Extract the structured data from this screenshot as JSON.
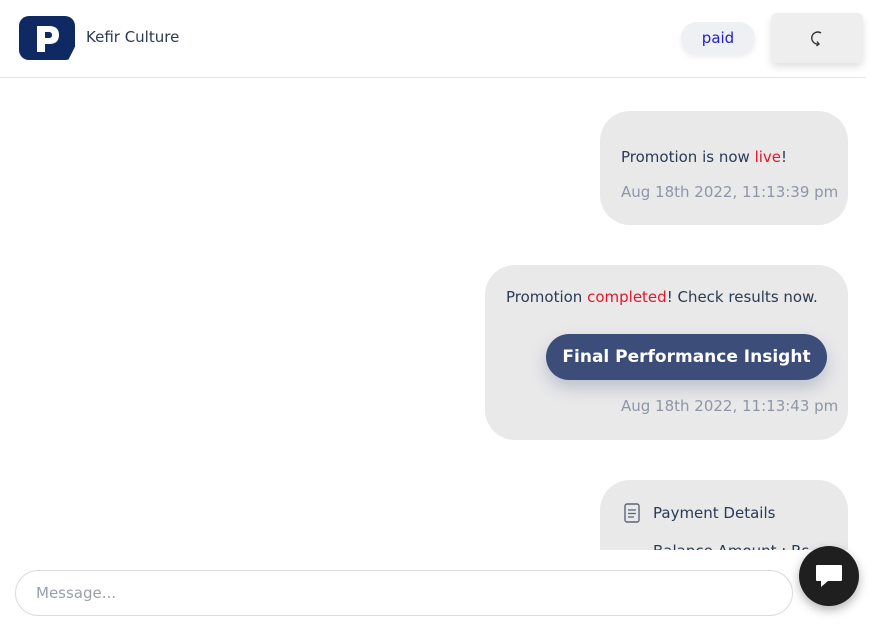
{
  "header": {
    "logo_icon": "brand-p-logo",
    "brand_name": "Kefir Culture",
    "status": "paid",
    "refresh_icon": "refresh-icon"
  },
  "messages": [
    {
      "text_before": "Promotion is now ",
      "highlight": "live",
      "text_after": "!",
      "timestamp": "Aug 18th 2022, 11:13:39 pm"
    },
    {
      "text_before": "Promotion ",
      "highlight": "completed",
      "text_after": "! Check results now.",
      "button_label": "Final Performance Insight",
      "timestamp": "Aug 18th 2022, 11:13:43 pm"
    },
    {
      "icon": "document-icon",
      "title": "Payment Details",
      "line": "Balance Amount : Rs"
    }
  ],
  "composer": {
    "placeholder": "Message...",
    "chat_icon": "chat-bubble-icon"
  },
  "colors": {
    "brand": "#0f2a63",
    "highlight": "#e8142a",
    "button": "#3b4d78",
    "status_text": "#2020d0"
  }
}
